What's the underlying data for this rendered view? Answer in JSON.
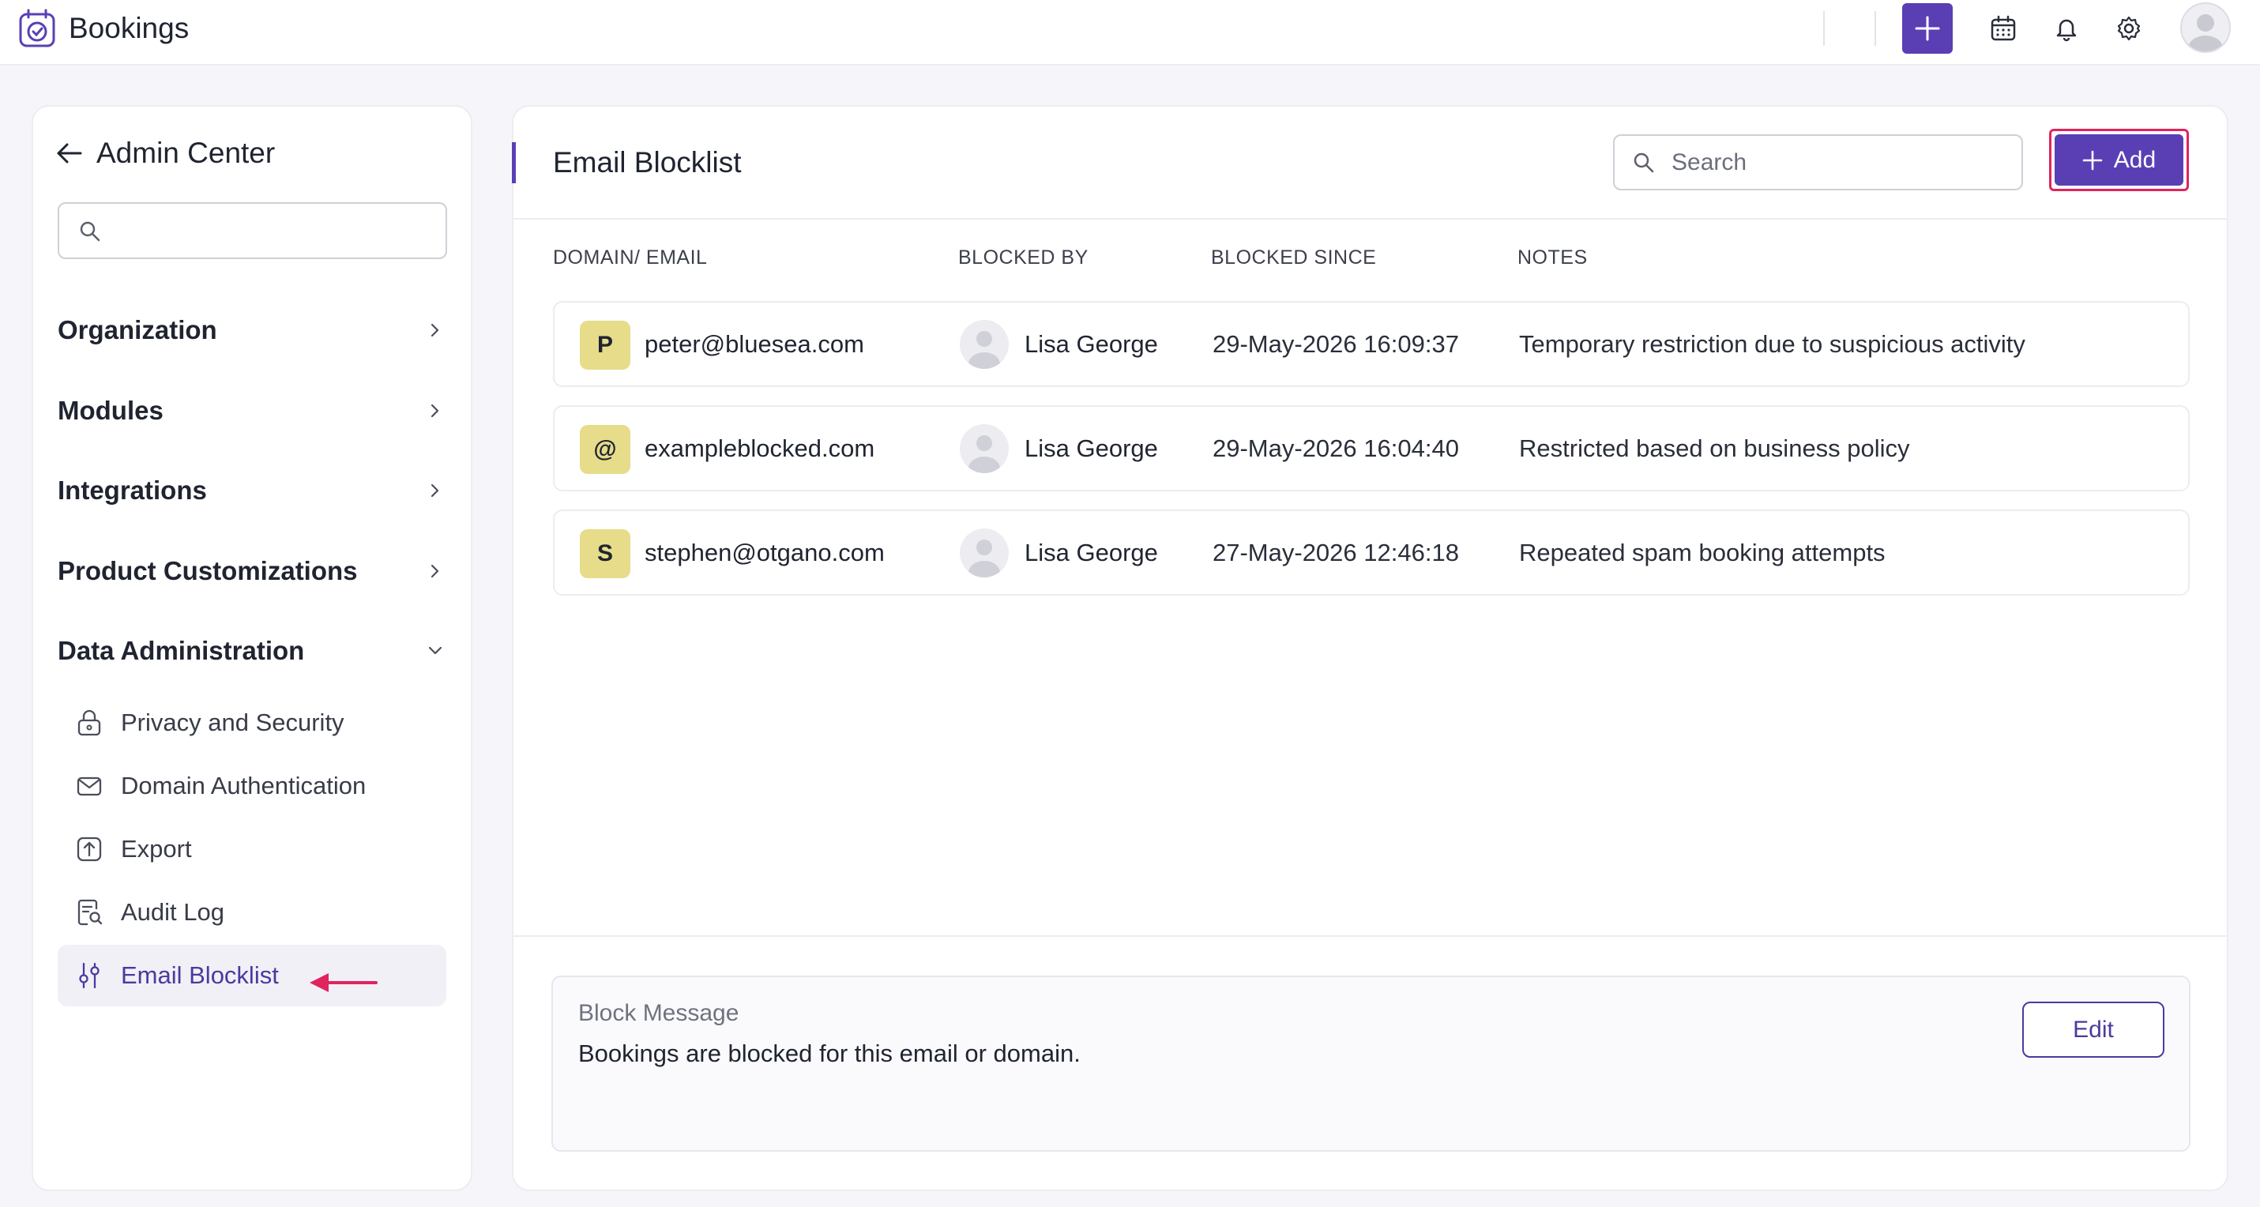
{
  "app": {
    "title": "Bookings"
  },
  "colors": {
    "accent": "#5a3fb4",
    "highlight": "#e0245e",
    "badge": "#e6dc8a"
  },
  "topbar": {
    "icons": [
      "app-logo-icon",
      "plus-icon",
      "calendar-icon",
      "bell-icon",
      "gear-icon",
      "avatar-icon"
    ]
  },
  "sidebar": {
    "title": "Admin Center",
    "search_placeholder": "",
    "sections": [
      {
        "label": "Organization"
      },
      {
        "label": "Modules"
      },
      {
        "label": "Integrations"
      },
      {
        "label": "Product Customizations"
      },
      {
        "label": "Data Administration",
        "expanded": true
      }
    ],
    "sub_items": [
      {
        "label": "Privacy and Security",
        "icon": "lock-icon"
      },
      {
        "label": "Domain Authentication",
        "icon": "mail-icon"
      },
      {
        "label": "Export",
        "icon": "export-icon"
      },
      {
        "label": "Audit Log",
        "icon": "audit-log-icon"
      },
      {
        "label": "Email Blocklist",
        "icon": "sliders-icon",
        "active": true
      }
    ]
  },
  "main": {
    "title": "Email Blocklist",
    "search_placeholder": "Search",
    "add_label": "Add",
    "columns": [
      "DOMAIN/ EMAIL",
      "BLOCKED BY",
      "BLOCKED SINCE",
      "NOTES"
    ],
    "rows": [
      {
        "badge": "P",
        "email": "peter@bluesea.com",
        "blocked_by": "Lisa George",
        "since": "29-May-2026 16:09:37",
        "notes": "Temporary restriction due to suspicious activity"
      },
      {
        "badge": "@",
        "email": "exampleblocked.com",
        "blocked_by": "Lisa George",
        "since": "29-May-2026 16:04:40",
        "notes": "Restricted based on business policy"
      },
      {
        "badge": "S",
        "email": "stephen@otgano.com",
        "blocked_by": "Lisa George",
        "since": "27-May-2026 12:46:18",
        "notes": "Repeated spam booking attempts"
      }
    ],
    "block_message": {
      "title": "Block Message",
      "text": "Bookings are blocked for this email or domain.",
      "edit_label": "Edit"
    }
  }
}
